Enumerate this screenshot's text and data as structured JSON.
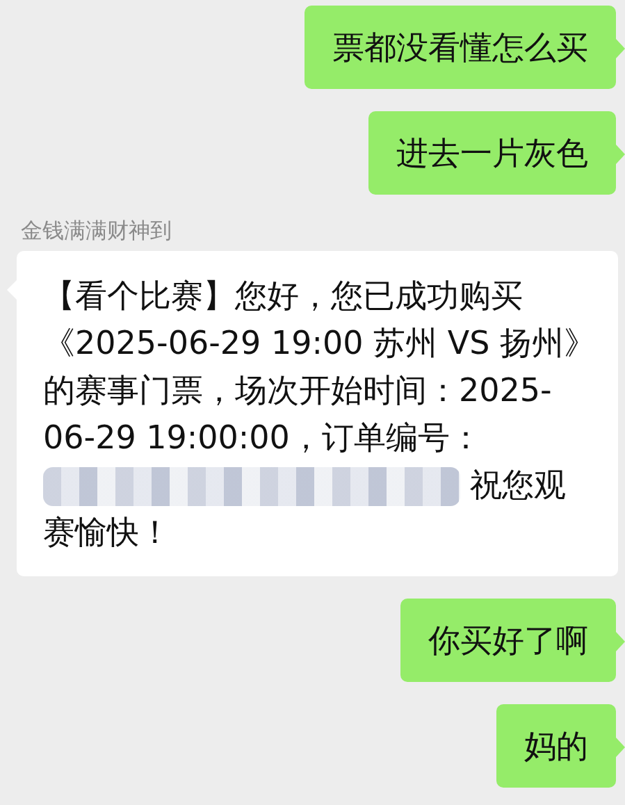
{
  "messages": [
    {
      "kind": "sent",
      "parts": [
        {
          "kind": "text",
          "text": "票都没看懂怎么买"
        }
      ]
    },
    {
      "kind": "sent",
      "parts": [
        {
          "kind": "text",
          "text": "进去一片灰色"
        }
      ]
    },
    {
      "kind": "received",
      "sender": "金钱满满财神到",
      "parts": [
        {
          "kind": "text",
          "text": "【看个比赛】您好，您已成功购买《2025-06-29 19:00 苏州 VS 扬州》的赛事门票，场次开始时间：2025-06-29 19:00:00，订单编号："
        },
        {
          "kind": "redacted"
        },
        {
          "kind": "text",
          "text": "祝您观"
        },
        {
          "kind": "text",
          "text": "赛愉快！"
        }
      ]
    },
    {
      "kind": "sent",
      "parts": [
        {
          "kind": "text",
          "text": "你买好了啊"
        }
      ]
    },
    {
      "kind": "sent",
      "parts": [
        {
          "kind": "text",
          "text": "妈的"
        }
      ]
    }
  ]
}
